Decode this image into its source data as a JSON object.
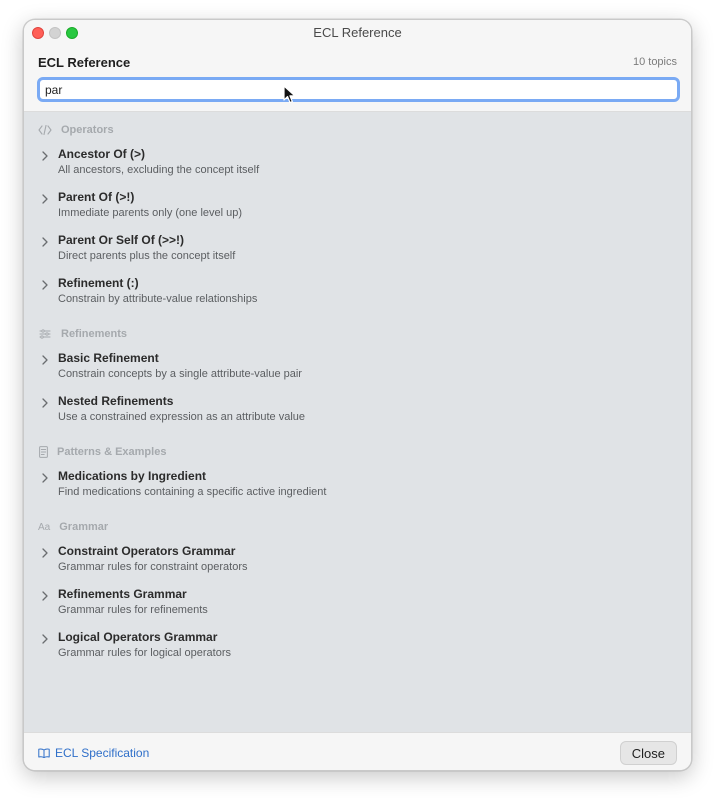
{
  "window": {
    "title": "ECL Reference"
  },
  "header": {
    "title": "ECL Reference",
    "topic_count": "10 topics"
  },
  "search": {
    "value": "par",
    "placeholder": ""
  },
  "sections": [
    {
      "title": "Operators",
      "icon": "code-icon",
      "items": [
        {
          "title": "Ancestor Of (>)",
          "desc": "All ancestors, excluding the concept itself"
        },
        {
          "title": "Parent Of (>!)",
          "desc": "Immediate parents only (one level up)"
        },
        {
          "title": "Parent Or Self Of (>>!)",
          "desc": "Direct parents plus the concept itself"
        },
        {
          "title": "Refinement (:)",
          "desc": "Constrain by attribute-value relationships"
        }
      ]
    },
    {
      "title": "Refinements",
      "icon": "sliders-icon",
      "items": [
        {
          "title": "Basic Refinement",
          "desc": "Constrain concepts by a single attribute-value pair"
        },
        {
          "title": "Nested Refinements",
          "desc": "Use a constrained expression as an attribute value"
        }
      ]
    },
    {
      "title": "Patterns & Examples",
      "icon": "document-icon",
      "items": [
        {
          "title": "Medications by Ingredient",
          "desc": "Find medications containing a specific active ingredient"
        }
      ]
    },
    {
      "title": "Grammar",
      "icon": "text-format-icon",
      "icon_text": "Aa",
      "items": [
        {
          "title": "Constraint Operators Grammar",
          "desc": "Grammar rules for constraint operators"
        },
        {
          "title": "Refinements Grammar",
          "desc": "Grammar rules for refinements"
        },
        {
          "title": "Logical Operators Grammar",
          "desc": "Grammar rules for logical operators"
        }
      ]
    }
  ],
  "footer": {
    "spec_link": "ECL Specification",
    "close_label": "Close"
  },
  "colors": {
    "accent": "#2f6fc9",
    "focus_ring": "#7aaaf4",
    "content_bg": "#e0e3e6",
    "close_dot": "#ff5f57",
    "maximize_dot": "#28c840"
  }
}
